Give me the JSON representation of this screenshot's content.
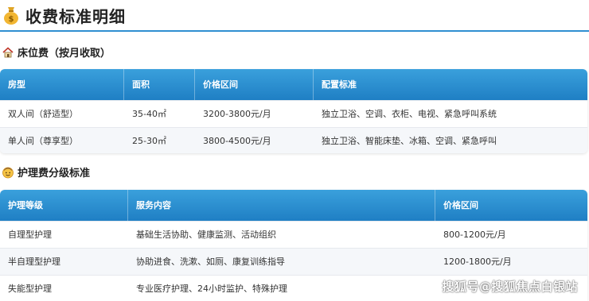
{
  "page": {
    "title": "收费标准明细",
    "title_icon": "money-bag-icon"
  },
  "bed_section": {
    "heading": "床位费（按月收取）",
    "icon": "house-icon",
    "headers": [
      "房型",
      "面积",
      "价格区间",
      "配置标准"
    ],
    "rows": [
      {
        "type": "双人间（舒适型）",
        "area": "35-40㎡",
        "price": "3200-3800元/月",
        "config": "独立卫浴、空调、衣柜、电视、紧急呼叫系统"
      },
      {
        "type": "单人间（尊享型）",
        "area": "25-30㎡",
        "price": "3800-4500元/月",
        "config": "独立卫浴、智能床垫、冰箱、空调、紧急呼叫"
      }
    ]
  },
  "care_section": {
    "heading": "护理费分级标准",
    "icon": "care-face-icon",
    "headers": [
      "护理等级",
      "服务内容",
      "价格区间"
    ],
    "rows": [
      {
        "level": "自理型护理",
        "content": "基础生活协助、健康监测、活动组织",
        "price": "800-1200元/月"
      },
      {
        "level": "半自理型护理",
        "content": "协助进食、洗漱、如厕、康复训练指导",
        "price": "1200-1800元/月"
      },
      {
        "level": "失能型护理",
        "content": "专业医疗护理、24小时监护、特殊护理",
        "price": ""
      }
    ]
  },
  "watermark": "搜狐号@搜狐焦点白银站",
  "colors": {
    "header_gradient_top": "#3aa0dc",
    "header_gradient_bottom": "#1f7fc4",
    "title_underline": "#2f8fd1",
    "alt_row": "#f5f7fa"
  }
}
